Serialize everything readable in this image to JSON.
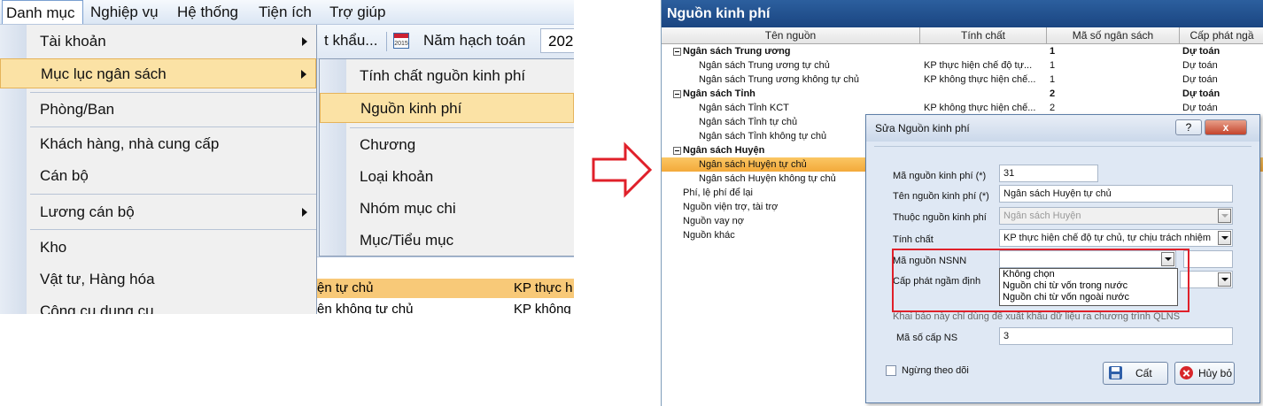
{
  "left": {
    "menubar": [
      "Danh mục",
      "Nghiệp vụ",
      "Hệ thống",
      "Tiện ích",
      "Trợ giúp"
    ],
    "toolbar": {
      "partial": "t khẩu...",
      "year_label": "Năm hạch toán",
      "year_value": "202",
      "cal_text": "2015"
    },
    "menu1": [
      "Tài khoản",
      "Mục lục ngân sách",
      "Phòng/Ban",
      "Khách hàng, nhà cung cấp",
      "Cán bộ",
      "Lương cán bộ",
      "Kho",
      "Vật tư, Hàng hóa",
      "Công cụ dụng cụ"
    ],
    "menu2": [
      "Tính chất nguồn kinh phí",
      "Nguồn kinh phí",
      "Chương",
      "Loại khoản",
      "Nhóm mục chi",
      "Mục/Tiểu mục"
    ],
    "bg_rows": [
      {
        "name": "ện tự chủ",
        "nature": "KP thực h"
      },
      {
        "name": "ện không tự chủ",
        "nature": "KP không"
      }
    ]
  },
  "right": {
    "title": "Nguồn kinh phí",
    "columns": [
      "Tên nguồn",
      "Tính chất",
      "Mã số ngân sách",
      "Cấp phát ngầ"
    ],
    "rows": [
      {
        "name": "Ngân sách Trung ương",
        "nature": "",
        "code": "1",
        "alloc": "Dự toán",
        "group": true
      },
      {
        "name": "Ngân sách Trung ương tự chủ",
        "nature": "KP thực hiện chế độ tự...",
        "code": "1",
        "alloc": "Dự toán"
      },
      {
        "name": "Ngân sách Trung ương không tự chủ",
        "nature": "KP không thực hiện chế...",
        "code": "1",
        "alloc": "Dự toán"
      },
      {
        "name": "Ngân sách Tỉnh",
        "nature": "",
        "code": "2",
        "alloc": "Dự toán",
        "group": true
      },
      {
        "name": "Ngân sách Tỉnh KCT",
        "nature": "KP không thực hiện chế...",
        "code": "2",
        "alloc": "Dự toán"
      },
      {
        "name": "Ngân sách Tỉnh tự chủ",
        "nature": "",
        "code": "",
        "alloc": ""
      },
      {
        "name": "Ngân sách Tỉnh không tự chủ",
        "nature": "",
        "code": "",
        "alloc": ""
      },
      {
        "name": "Ngân sách Huyện",
        "nature": "",
        "code": "",
        "alloc": "",
        "group": true
      },
      {
        "name": "Ngân sách Huyện tự chủ",
        "nature": "",
        "code": "",
        "alloc": ""
      },
      {
        "name": "Ngân sách Huyện không tự chủ",
        "nature": "",
        "code": "",
        "alloc": ""
      },
      {
        "name": "Phí, lệ phí để lại",
        "nature": "",
        "code": "",
        "alloc": ""
      },
      {
        "name": "Nguồn viện trợ, tài trợ",
        "nature": "",
        "code": "",
        "alloc": ""
      },
      {
        "name": "Nguồn vay nợ",
        "nature": "",
        "code": "",
        "alloc": ""
      },
      {
        "name": "Nguồn khác",
        "nature": "",
        "code": "",
        "alloc": ""
      }
    ]
  },
  "dialog": {
    "title": "Sửa Nguồn kinh phí",
    "help": "?",
    "close": "x",
    "fields": {
      "code_label": "Mã nguồn kinh phí (*)",
      "code_value": "31",
      "name_label": "Tên nguồn kinh phí (*)",
      "name_value": "Ngân sách Huyện tự chủ",
      "parent_label": "Thuộc nguồn kinh phí",
      "parent_value": "Ngân sách Huyện",
      "nature_label": "Tính chất",
      "nature_value": "KP thực hiện chế độ tự chủ, tự chịu trách nhiệm",
      "nsnn_label": "Mã nguồn NSNN",
      "nsnn_value": "",
      "alloc_label": "Cấp phát ngầm định",
      "note": "Khai báo này chỉ dùng để xuất khẩu dữ liệu ra chương trình QLNS",
      "level_label": "Mã số cấp NS",
      "level_value": "3",
      "stop_label": "Ngừng theo dõi"
    },
    "dropdown_options": [
      "Không chọn",
      "Nguồn chi từ vốn trong nước",
      "Nguồn chi từ vốn ngoài nước"
    ],
    "save": "Cất",
    "cancel": "Hủy bỏ"
  },
  "colors": {
    "highlight": "#fbe2a5",
    "title_blue": "#1a4581",
    "red_annotation": "#e0202a"
  }
}
